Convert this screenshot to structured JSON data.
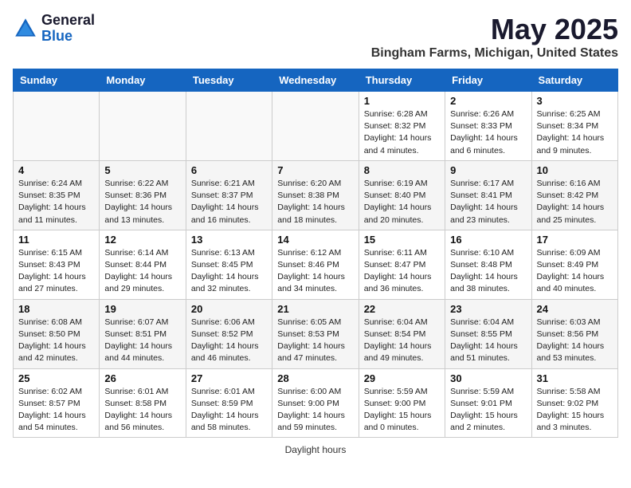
{
  "logo": {
    "general": "General",
    "blue": "Blue",
    "url": "generalblue.com"
  },
  "title": "May 2025",
  "location": "Bingham Farms, Michigan, United States",
  "days_of_week": [
    "Sunday",
    "Monday",
    "Tuesday",
    "Wednesday",
    "Thursday",
    "Friday",
    "Saturday"
  ],
  "footer": {
    "daylight_label": "Daylight hours"
  },
  "weeks": [
    [
      {
        "day": "",
        "info": ""
      },
      {
        "day": "",
        "info": ""
      },
      {
        "day": "",
        "info": ""
      },
      {
        "day": "",
        "info": ""
      },
      {
        "day": "1",
        "info": "Sunrise: 6:28 AM\nSunset: 8:32 PM\nDaylight: 14 hours\nand 4 minutes."
      },
      {
        "day": "2",
        "info": "Sunrise: 6:26 AM\nSunset: 8:33 PM\nDaylight: 14 hours\nand 6 minutes."
      },
      {
        "day": "3",
        "info": "Sunrise: 6:25 AM\nSunset: 8:34 PM\nDaylight: 14 hours\nand 9 minutes."
      }
    ],
    [
      {
        "day": "4",
        "info": "Sunrise: 6:24 AM\nSunset: 8:35 PM\nDaylight: 14 hours\nand 11 minutes."
      },
      {
        "day": "5",
        "info": "Sunrise: 6:22 AM\nSunset: 8:36 PM\nDaylight: 14 hours\nand 13 minutes."
      },
      {
        "day": "6",
        "info": "Sunrise: 6:21 AM\nSunset: 8:37 PM\nDaylight: 14 hours\nand 16 minutes."
      },
      {
        "day": "7",
        "info": "Sunrise: 6:20 AM\nSunset: 8:38 PM\nDaylight: 14 hours\nand 18 minutes."
      },
      {
        "day": "8",
        "info": "Sunrise: 6:19 AM\nSunset: 8:40 PM\nDaylight: 14 hours\nand 20 minutes."
      },
      {
        "day": "9",
        "info": "Sunrise: 6:17 AM\nSunset: 8:41 PM\nDaylight: 14 hours\nand 23 minutes."
      },
      {
        "day": "10",
        "info": "Sunrise: 6:16 AM\nSunset: 8:42 PM\nDaylight: 14 hours\nand 25 minutes."
      }
    ],
    [
      {
        "day": "11",
        "info": "Sunrise: 6:15 AM\nSunset: 8:43 PM\nDaylight: 14 hours\nand 27 minutes."
      },
      {
        "day": "12",
        "info": "Sunrise: 6:14 AM\nSunset: 8:44 PM\nDaylight: 14 hours\nand 29 minutes."
      },
      {
        "day": "13",
        "info": "Sunrise: 6:13 AM\nSunset: 8:45 PM\nDaylight: 14 hours\nand 32 minutes."
      },
      {
        "day": "14",
        "info": "Sunrise: 6:12 AM\nSunset: 8:46 PM\nDaylight: 14 hours\nand 34 minutes."
      },
      {
        "day": "15",
        "info": "Sunrise: 6:11 AM\nSunset: 8:47 PM\nDaylight: 14 hours\nand 36 minutes."
      },
      {
        "day": "16",
        "info": "Sunrise: 6:10 AM\nSunset: 8:48 PM\nDaylight: 14 hours\nand 38 minutes."
      },
      {
        "day": "17",
        "info": "Sunrise: 6:09 AM\nSunset: 8:49 PM\nDaylight: 14 hours\nand 40 minutes."
      }
    ],
    [
      {
        "day": "18",
        "info": "Sunrise: 6:08 AM\nSunset: 8:50 PM\nDaylight: 14 hours\nand 42 minutes."
      },
      {
        "day": "19",
        "info": "Sunrise: 6:07 AM\nSunset: 8:51 PM\nDaylight: 14 hours\nand 44 minutes."
      },
      {
        "day": "20",
        "info": "Sunrise: 6:06 AM\nSunset: 8:52 PM\nDaylight: 14 hours\nand 46 minutes."
      },
      {
        "day": "21",
        "info": "Sunrise: 6:05 AM\nSunset: 8:53 PM\nDaylight: 14 hours\nand 47 minutes."
      },
      {
        "day": "22",
        "info": "Sunrise: 6:04 AM\nSunset: 8:54 PM\nDaylight: 14 hours\nand 49 minutes."
      },
      {
        "day": "23",
        "info": "Sunrise: 6:04 AM\nSunset: 8:55 PM\nDaylight: 14 hours\nand 51 minutes."
      },
      {
        "day": "24",
        "info": "Sunrise: 6:03 AM\nSunset: 8:56 PM\nDaylight: 14 hours\nand 53 minutes."
      }
    ],
    [
      {
        "day": "25",
        "info": "Sunrise: 6:02 AM\nSunset: 8:57 PM\nDaylight: 14 hours\nand 54 minutes."
      },
      {
        "day": "26",
        "info": "Sunrise: 6:01 AM\nSunset: 8:58 PM\nDaylight: 14 hours\nand 56 minutes."
      },
      {
        "day": "27",
        "info": "Sunrise: 6:01 AM\nSunset: 8:59 PM\nDaylight: 14 hours\nand 58 minutes."
      },
      {
        "day": "28",
        "info": "Sunrise: 6:00 AM\nSunset: 9:00 PM\nDaylight: 14 hours\nand 59 minutes."
      },
      {
        "day": "29",
        "info": "Sunrise: 5:59 AM\nSunset: 9:00 PM\nDaylight: 15 hours\nand 0 minutes."
      },
      {
        "day": "30",
        "info": "Sunrise: 5:59 AM\nSunset: 9:01 PM\nDaylight: 15 hours\nand 2 minutes."
      },
      {
        "day": "31",
        "info": "Sunrise: 5:58 AM\nSunset: 9:02 PM\nDaylight: 15 hours\nand 3 minutes."
      }
    ]
  ]
}
